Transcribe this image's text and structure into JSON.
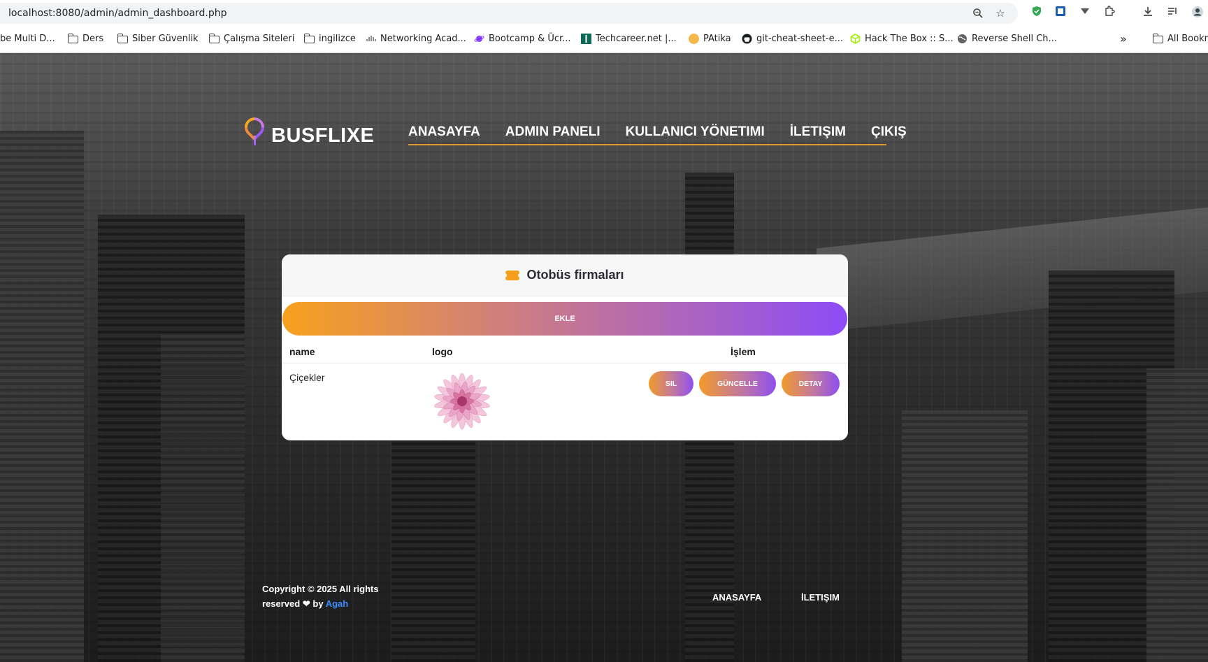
{
  "browser": {
    "url": "localhost:8080/admin/admin_dashboard.php",
    "bookmarks": [
      {
        "label": "be Multi D...",
        "icon": "none"
      },
      {
        "label": "Ders",
        "icon": "folder-icon"
      },
      {
        "label": "Siber Güvenlik",
        "icon": "folder-icon"
      },
      {
        "label": "Çalışma Siteleri",
        "icon": "folder-icon"
      },
      {
        "label": "ingilizce",
        "icon": "folder-icon"
      },
      {
        "label": "Networking Acad...",
        "icon": "cisco-icon"
      },
      {
        "label": "Bootcamp & Ücr...",
        "icon": "planet-icon"
      },
      {
        "label": "Techcareer.net |...",
        "icon": "techcareer-icon"
      },
      {
        "label": "PAtika",
        "icon": "patika-icon"
      },
      {
        "label": "git-cheat-sheet-e...",
        "icon": "github-icon"
      },
      {
        "label": "Hack The Box :: S...",
        "icon": "htb-icon"
      },
      {
        "label": "Reverse Shell Ch...",
        "icon": "globe-icon"
      }
    ],
    "more_bookmarks": "»",
    "all_bookmarks": "All Bookm"
  },
  "site": {
    "brand": "BUSFLIXE",
    "nav": [
      "ANASAYFA",
      "ADMIN PANELI",
      "KULLANICI YÖNETIMI",
      "İLETIŞIM",
      "ÇIKIŞ"
    ]
  },
  "card": {
    "title": "Otobüs firmaları",
    "add_label": "EKLE",
    "columns": {
      "name": "name",
      "logo": "logo",
      "action": "İşlem"
    },
    "rows": [
      {
        "name": "Çiçekler",
        "actions": {
          "delete": "SIL",
          "update": "GÜNCELLE",
          "detail": "DETAY"
        }
      }
    ]
  },
  "footer": {
    "copyright_line1": "Copyright © 2025 All rights",
    "copyright_line2_prefix": "reserved",
    "copyright_by": "by",
    "author": "Agah",
    "links": [
      "ANASAYFA",
      "İLETIŞIM"
    ]
  },
  "colors": {
    "accent_orange": "#f7a11e",
    "accent_purple": "#8d4cf7",
    "nav_underline": "#e0922d",
    "link_blue": "#3b8cff"
  }
}
